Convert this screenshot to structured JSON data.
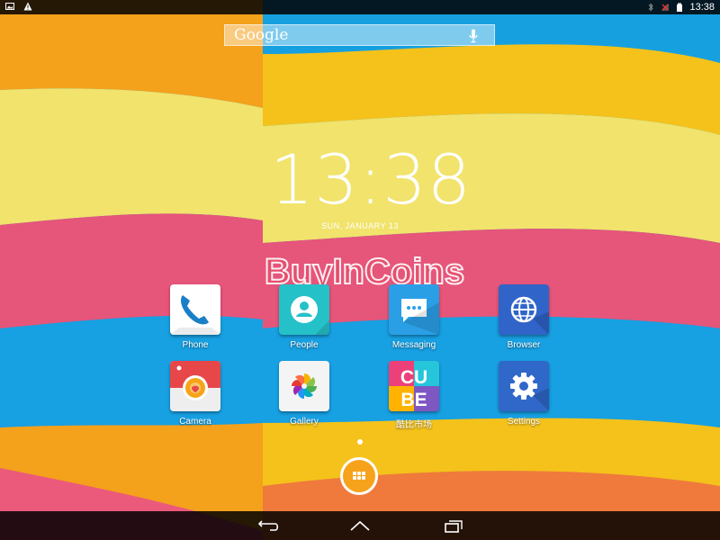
{
  "status_bar": {
    "time": "13:38",
    "left_icons": [
      "image-notification-icon",
      "warning-icon"
    ],
    "right_icons": [
      "bluetooth-icon",
      "no-signal-icon",
      "battery-icon"
    ]
  },
  "search": {
    "logo_text": "Google",
    "mic_icon": "mic-icon"
  },
  "clock": {
    "time": "13:38",
    "date": "SUN, JANUARY 13"
  },
  "watermark": "BuyInCoins",
  "apps": [
    {
      "label": "Phone",
      "icon": "phone-icon"
    },
    {
      "label": "People",
      "icon": "people-icon"
    },
    {
      "label": "Messaging",
      "icon": "messaging-icon"
    },
    {
      "label": "Browser",
      "icon": "browser-icon"
    },
    {
      "label": "Camera",
      "icon": "camera-icon"
    },
    {
      "label": "Gallery",
      "icon": "gallery-icon"
    },
    {
      "label": "酷比市场",
      "icon": "cube-market-icon",
      "tile_text": [
        "CU",
        "BE"
      ]
    },
    {
      "label": "Settings",
      "icon": "settings-icon"
    }
  ],
  "nav": {
    "back": "back-icon",
    "home": "home-icon",
    "recents": "recents-icon"
  }
}
